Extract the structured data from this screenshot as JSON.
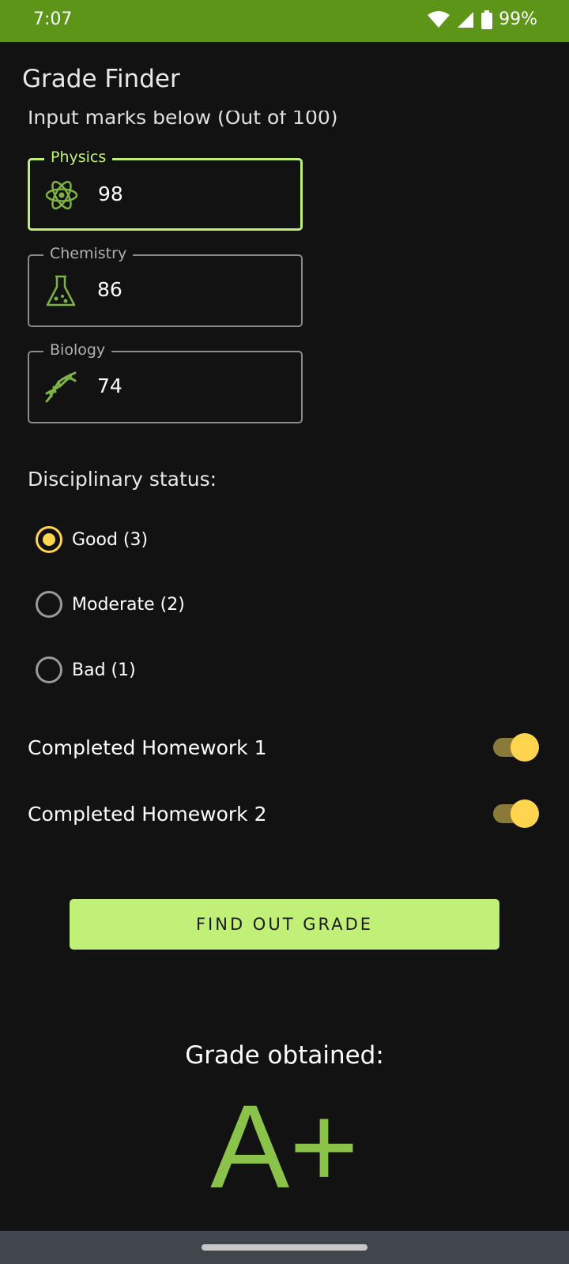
{
  "status_bar": {
    "time": "7:07",
    "battery": "99%",
    "icons": [
      "wifi-icon",
      "signal-icon",
      "battery-icon"
    ],
    "color": "#5d9518"
  },
  "app": {
    "title": "Grade Finder"
  },
  "form": {
    "instructions": "Input marks below (Out of 100)",
    "fields": [
      {
        "label": "Physics",
        "value": "98",
        "icon": "atom-icon"
      },
      {
        "label": "Chemistry",
        "value": "86",
        "icon": "flask-icon"
      },
      {
        "label": "Biology",
        "value": "74",
        "icon": "dna-icon"
      }
    ],
    "discipline_label": "Disciplinary status:",
    "discipline_options": [
      {
        "label": "Good (3)",
        "checked": true
      },
      {
        "label": "Moderate (2)",
        "checked": false
      },
      {
        "label": "Bad (1)",
        "checked": false
      }
    ],
    "switches": [
      {
        "label": "Completed Homework 1",
        "on": true
      },
      {
        "label": "Completed Homework 2",
        "on": true
      }
    ],
    "button_label": "FIND OUT GRADE"
  },
  "result": {
    "heading": "Grade obtained:",
    "grade": "A+"
  },
  "colors": {
    "accent": "#c0f077",
    "selection": "#ffd54f",
    "grade": "#8bc34a",
    "background": "#121212"
  }
}
